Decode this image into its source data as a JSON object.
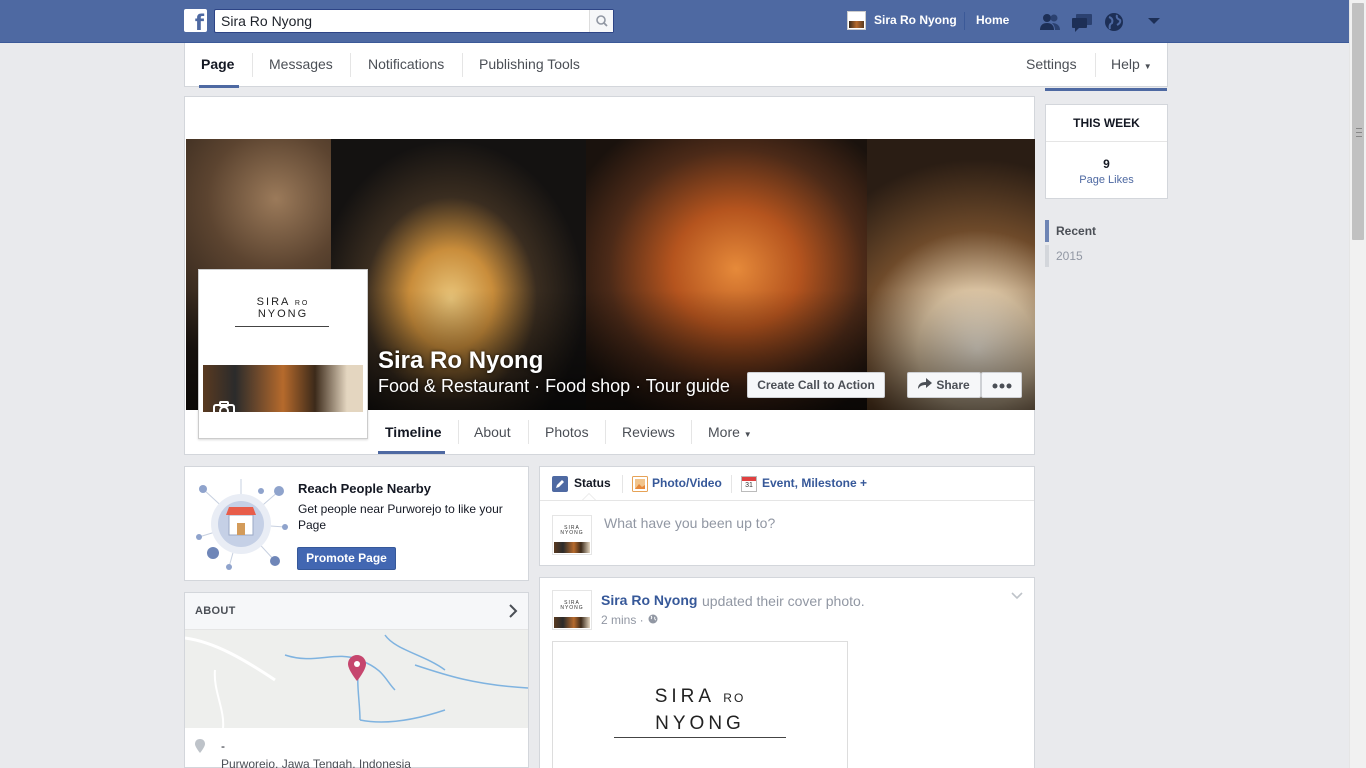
{
  "topbar": {
    "search_value": "Sira Ro Nyong",
    "user_name": "Sira Ro Nyong",
    "home_label": "Home"
  },
  "page_nav": {
    "tabs": [
      "Page",
      "Messages",
      "Notifications",
      "Publishing Tools"
    ],
    "settings_label": "Settings",
    "help_label": "Help"
  },
  "cover": {
    "page_name": "Sira Ro Nyong",
    "categories": "Food & Restaurant · Food shop · Tour guide",
    "cta_label": "Create Call to Action",
    "share_label": "Share",
    "logo_line1": "SIRA",
    "logo_ro": "RO",
    "logo_line2": "NYONG"
  },
  "timeline_tabs": [
    "Timeline",
    "About",
    "Photos",
    "Reviews",
    "More"
  ],
  "this_week": {
    "heading": "THIS WEEK",
    "count": "9",
    "label": "Page Likes"
  },
  "year_nav": [
    "Recent",
    "2015"
  ],
  "reach": {
    "title": "Reach People Nearby",
    "text": "Get people near Purworejo to like your Page",
    "button": "Promote Page"
  },
  "about": {
    "title": "ABOUT",
    "dash": "-",
    "location": "Purworejo, Jawa Tengah, Indonesia"
  },
  "composer": {
    "tab_status": "Status",
    "tab_photo": "Photo/Video",
    "tab_event": "Event, Milestone +",
    "calendar_day": "31",
    "placeholder": "What have you been up to?"
  },
  "post": {
    "author": "Sira Ro Nyong",
    "action": "updated their cover photo.",
    "time": "2 mins ·"
  },
  "colors": {
    "brand_blue": "#4e69a2",
    "link_blue": "#365899",
    "button_blue": "#4267b2"
  }
}
